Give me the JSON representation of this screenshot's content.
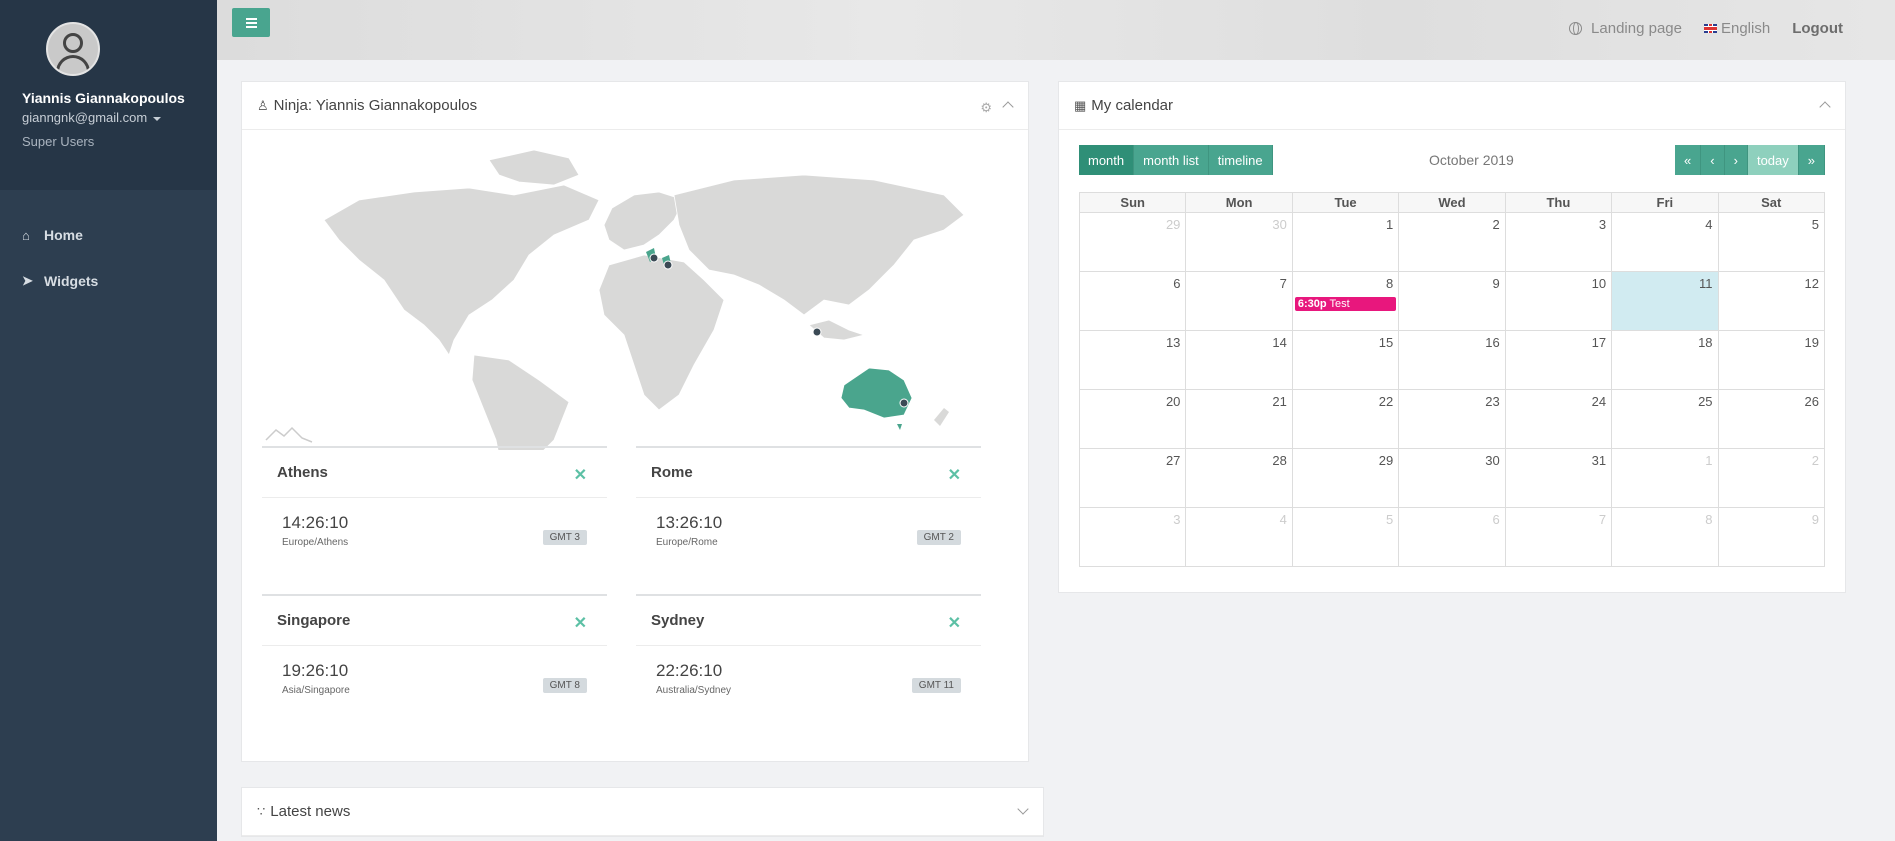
{
  "sidebar": {
    "profile": {
      "name": "Yiannis Giannakopoulos",
      "email": "gianngnk@gmail.com",
      "role": "Super Users"
    },
    "items": [
      {
        "label": "Home",
        "icon": "home-icon"
      },
      {
        "label": "Widgets",
        "icon": "rocket-icon"
      }
    ]
  },
  "topbar": {
    "landing": "Landing page",
    "language": "English",
    "logout": "Logout"
  },
  "ninja_panel": {
    "title": "Ninja: Yiannis Giannakopoulos",
    "cities": [
      {
        "name": "Athens",
        "time": "14:26:10",
        "tz": "Europe/Athens",
        "gmt": "GMT 3"
      },
      {
        "name": "Rome",
        "time": "13:26:10",
        "tz": "Europe/Rome",
        "gmt": "GMT 2"
      },
      {
        "name": "Singapore",
        "time": "19:26:10",
        "tz": "Asia/Singapore",
        "gmt": "GMT 8"
      },
      {
        "name": "Sydney",
        "time": "22:26:10",
        "tz": "Australia/Sydney",
        "gmt": "GMT 11"
      }
    ]
  },
  "calendar_panel": {
    "title": "My calendar",
    "view_buttons": [
      "month",
      "month list",
      "timeline"
    ],
    "month_title": "October 2019",
    "today_label": "today",
    "weekdays": [
      "Sun",
      "Mon",
      "Tue",
      "Wed",
      "Thu",
      "Fri",
      "Sat"
    ],
    "weeks": [
      [
        "29",
        "30",
        "1",
        "2",
        "3",
        "4",
        "5"
      ],
      [
        "6",
        "7",
        "8",
        "9",
        "10",
        "11",
        "12"
      ],
      [
        "13",
        "14",
        "15",
        "16",
        "17",
        "18",
        "19"
      ],
      [
        "20",
        "21",
        "22",
        "23",
        "24",
        "25",
        "26"
      ],
      [
        "27",
        "28",
        "29",
        "30",
        "31",
        "1",
        "2"
      ],
      [
        "3",
        "4",
        "5",
        "6",
        "7",
        "8",
        "9"
      ]
    ],
    "event": {
      "time": "6:30p",
      "title": "Test",
      "color": "#e8177d"
    }
  },
  "news_panel": {
    "title": "Latest news"
  },
  "colors": {
    "accent": "#49a58f",
    "sidebar": "#2d3e50",
    "map_highlight": "#4aa58d"
  }
}
